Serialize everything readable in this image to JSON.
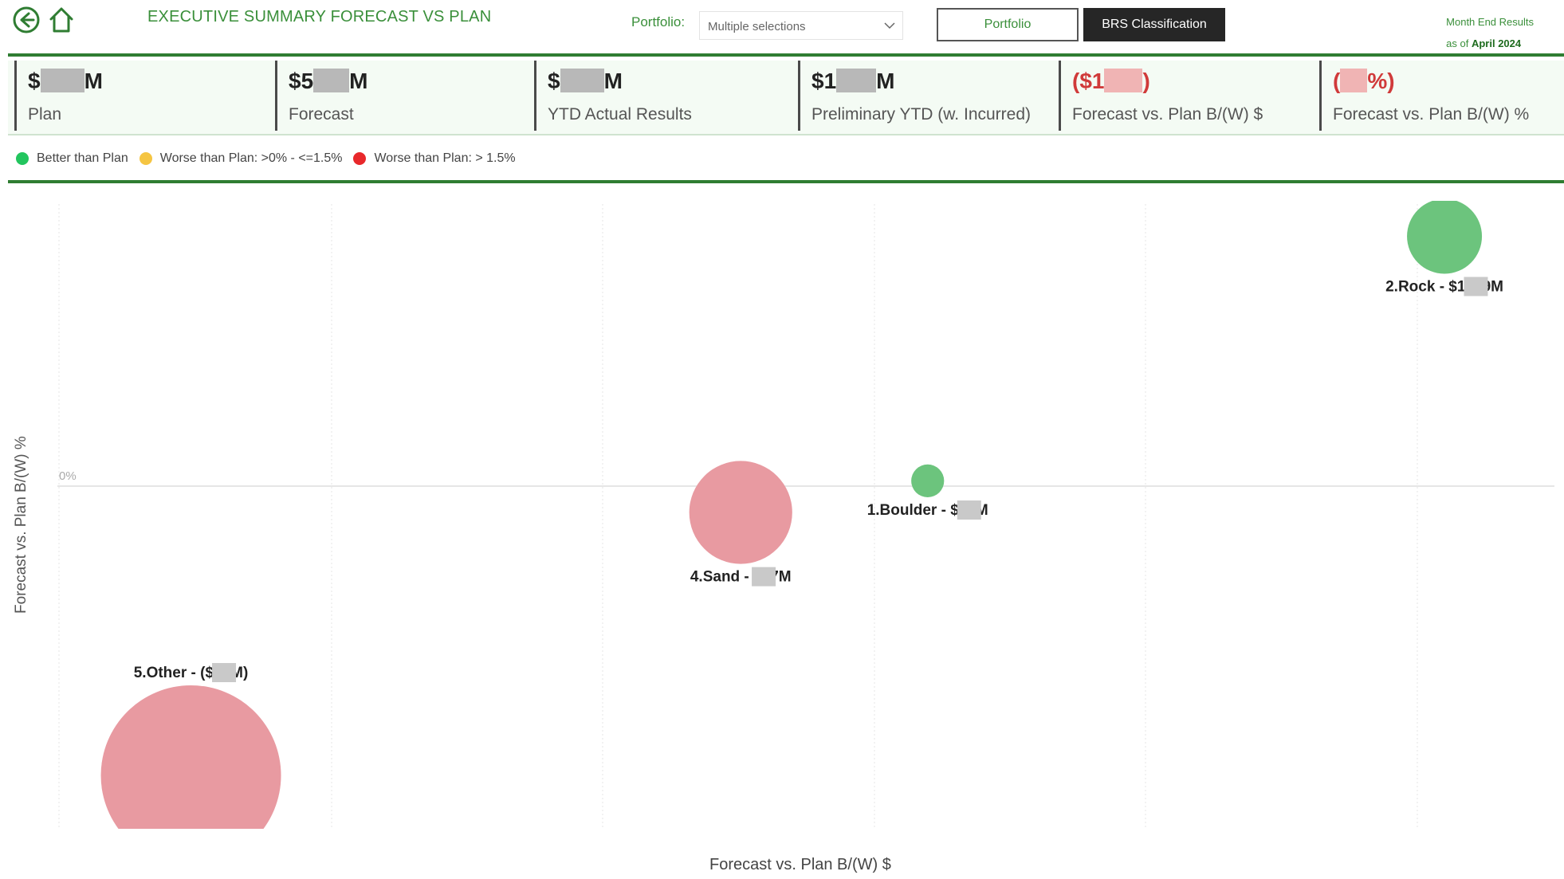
{
  "header": {
    "title": "EXECUTIVE SUMMARY FORECAST VS PLAN",
    "portfolio_label": "Portfolio:",
    "portfolio_value": "Multiple selections",
    "toggle_portfolio": "Portfolio",
    "toggle_brs": "BRS Classification",
    "asof_line1": "Month End Results",
    "asof_line2_prefix": "as of",
    "asof_line2_date": "April 2024"
  },
  "kpis": [
    {
      "prefix": "$",
      "suffix": "M",
      "label": "Plan",
      "negative": false
    },
    {
      "prefix": "$5",
      "suffix": "M",
      "label": "Forecast",
      "negative": false
    },
    {
      "prefix": "$",
      "suffix": "M",
      "label": "YTD Actual Results",
      "negative": false
    },
    {
      "prefix": "$1",
      "suffix": "M",
      "label": "Preliminary YTD (w. Incurred)",
      "negative": false
    },
    {
      "prefix": "($1",
      "suffix": ")",
      "label": "Forecast vs. Plan B/(W) $",
      "negative": true
    },
    {
      "prefix": "(",
      "suffix": "%)",
      "label": "Forecast vs. Plan B/(W) %",
      "negative": true
    }
  ],
  "legend": [
    {
      "label": "Better than Plan",
      "color": "#22c55e"
    },
    {
      "label": "Worse than Plan: >0% - <=1.5%",
      "color": "#f5c542"
    },
    {
      "label": "Worse than Plan: > 1.5%",
      "color": "#e8282b"
    }
  ],
  "chart_data": {
    "type": "scatter",
    "xlabel": "Forecast vs. Plan B/(W) $",
    "ylabel": "Forecast vs. Plan B/(W) %",
    "y_tick_label": "0%",
    "grid": true,
    "points": [
      {
        "label_prefix": "2.Rock - $1",
        "label_suffix": "9M",
        "status": "better",
        "size": 3,
        "x": 5.6,
        "y": 0.95
      },
      {
        "label_prefix": "1.Boulder - $",
        "label_suffix": "M",
        "status": "better",
        "size": 0.6,
        "x": 0.9,
        "y": 0.02
      },
      {
        "label_prefix": "4.Sand - ",
        "label_suffix": "7M",
        "status": "worse_high",
        "size": 4.6,
        "x": -0.8,
        "y": -0.1
      },
      {
        "label_prefix": "5.Other - ($",
        "label_suffix": "M)",
        "status": "worse_high",
        "size": 9,
        "x": -5.8,
        "y": -1.1
      }
    ],
    "colors": {
      "better": "#6cc47d",
      "worse_high": "#e89aa1"
    }
  }
}
